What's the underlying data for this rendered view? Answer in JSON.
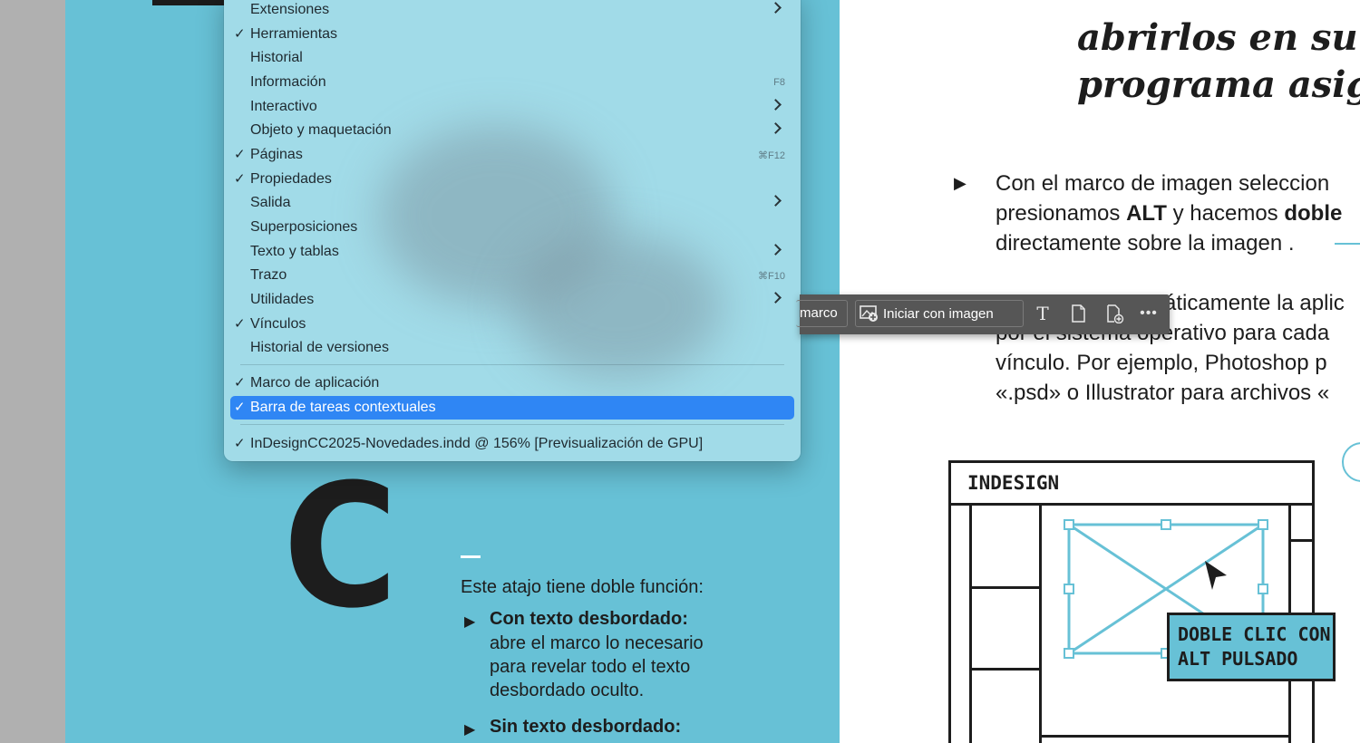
{
  "menu": {
    "items": [
      {
        "label": "Extensiones",
        "checked": false,
        "shortcut": "",
        "submenu": true
      },
      {
        "label": "Herramientas",
        "checked": true,
        "shortcut": "",
        "submenu": false
      },
      {
        "label": "Historial",
        "checked": false,
        "shortcut": "",
        "submenu": false
      },
      {
        "label": "Información",
        "checked": false,
        "shortcut": "F8",
        "submenu": false
      },
      {
        "label": "Interactivo",
        "checked": false,
        "shortcut": "",
        "submenu": true
      },
      {
        "label": "Objeto y maquetación",
        "checked": false,
        "shortcut": "",
        "submenu": true
      },
      {
        "label": "Páginas",
        "checked": true,
        "shortcut": "⌘F12",
        "submenu": false
      },
      {
        "label": "Propiedades",
        "checked": true,
        "shortcut": "",
        "submenu": false
      },
      {
        "label": "Salida",
        "checked": false,
        "shortcut": "",
        "submenu": true
      },
      {
        "label": "Superposiciones",
        "checked": false,
        "shortcut": "",
        "submenu": false
      },
      {
        "label": "Texto y tablas",
        "checked": false,
        "shortcut": "",
        "submenu": true
      },
      {
        "label": "Trazo",
        "checked": false,
        "shortcut": "⌘F10",
        "submenu": false
      },
      {
        "label": "Utilidades",
        "checked": false,
        "shortcut": "",
        "submenu": true
      },
      {
        "label": "Vínculos",
        "checked": true,
        "shortcut": "",
        "submenu": false
      },
      {
        "label": "Historial de versiones",
        "checked": false,
        "shortcut": "",
        "submenu": false
      }
    ],
    "group2": [
      {
        "label": "Marco de aplicación",
        "checked": true
      },
      {
        "label": "Barra de tareas contextuales",
        "checked": true,
        "highlighted": true
      }
    ],
    "document_item": {
      "label": "InDesignCC2025-Novedades.indd @ 156% [Previsualización de GPU]",
      "checked": true
    },
    "check_glyph": "✓",
    "highlight_color": "#2f86f4"
  },
  "contextual_bar": {
    "partial_label": "marco",
    "start_with_image_label": "Iniciar con imagen",
    "icons": [
      "add-image-icon",
      "text-icon",
      "page-icon",
      "add-page-icon",
      "more-icon"
    ]
  },
  "left_page": {
    "big_letter": "C",
    "intro": "Este atajo tiene doble función:",
    "items": [
      {
        "title": "Con texto desbordado:",
        "body": [
          "abre el marco lo necesario",
          "para revelar todo el texto",
          "desbordado oculto."
        ]
      },
      {
        "title": "Sin texto desbordado:",
        "body": []
      }
    ],
    "bullet_glyph": "▶",
    "background": "#67c1d6"
  },
  "right_page": {
    "title_lines": [
      "abrirlos en su",
      "programa asig"
    ],
    "para1": {
      "pre1": "Con el marco de imagen seleccion",
      "pre2a": "presionamos ",
      "bold1": "ALT",
      "pre2b": " y hacemos ",
      "bold2": "doble",
      "line3": "directamente sobre la imagen ."
    },
    "para2": [
      "áticamente la aplic",
      "por el sistema operativo para cada",
      "vínculo. Por ejemplo, Photoshop p",
      "«.psd» o Illustrator para archivos «"
    ],
    "diagram_title": "INDESIGN",
    "callout": [
      "DOBLE CLIC CON",
      "ALT PULSADO"
    ]
  }
}
